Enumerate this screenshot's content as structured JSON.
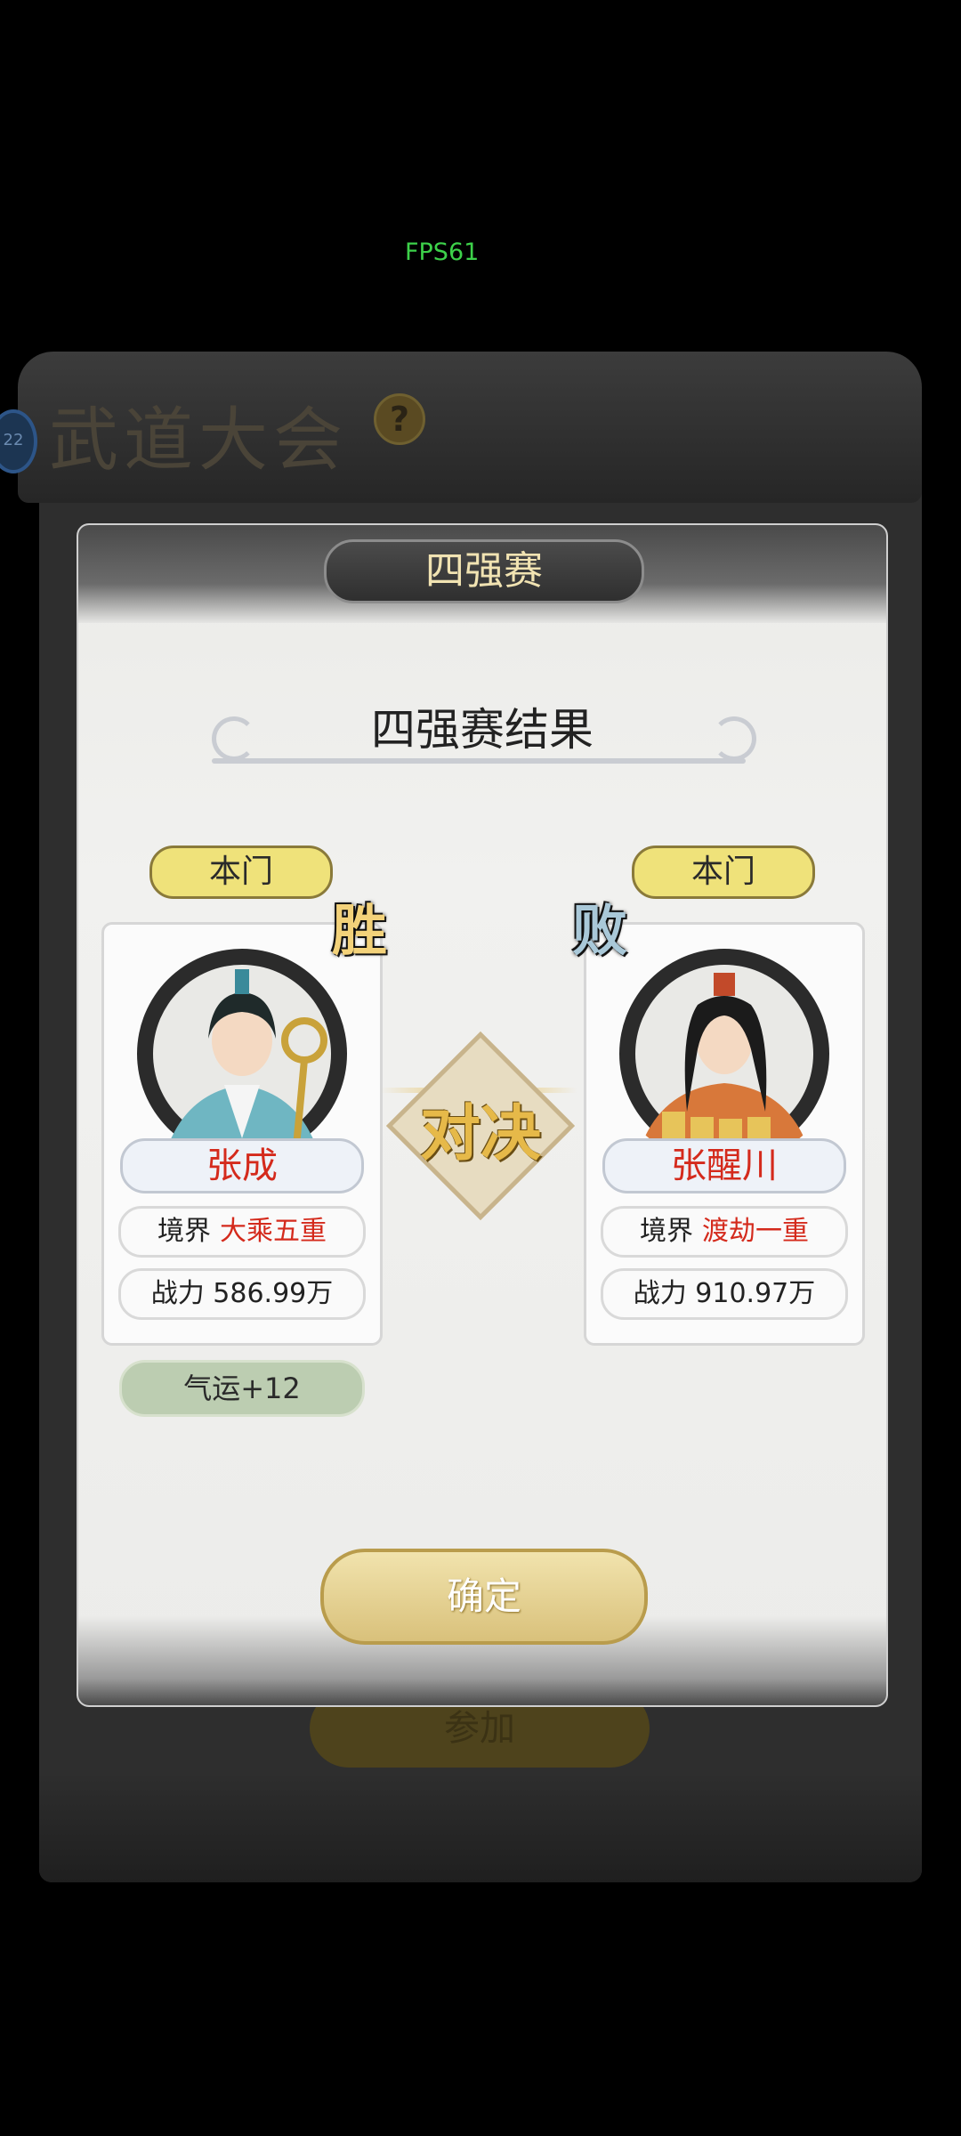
{
  "overlay": {
    "fps_label": "FPS61"
  },
  "background": {
    "title": "武道大会",
    "help_glyph": "?",
    "level_badge": "22",
    "join_button_label": "参加"
  },
  "modal": {
    "tab_title": "四强赛",
    "result_title": "四强赛结果",
    "vs_label": "对决",
    "confirm_label": "确定",
    "winner": {
      "sect_tag": "本门",
      "result_mark": "胜",
      "name": "张成",
      "realm_label": "境界",
      "realm_value": "大乘五重",
      "power_text": "战力 586.99万",
      "reward": "气运+12",
      "outfit_color": "#6fb6c2"
    },
    "loser": {
      "sect_tag": "本门",
      "result_mark": "败",
      "name": "张醒川",
      "realm_label": "境界",
      "realm_value": "渡劫一重",
      "power_text": "战力 910.97万",
      "outfit_color": "#d8783a"
    }
  }
}
